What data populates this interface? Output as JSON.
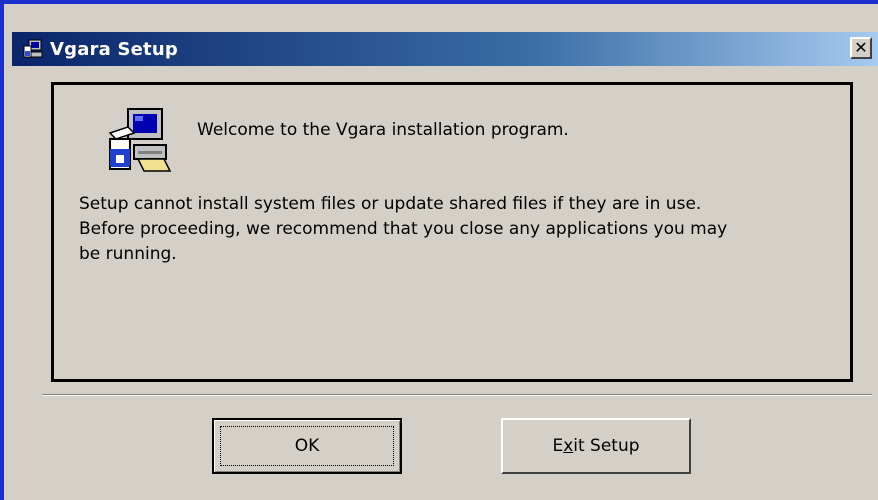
{
  "window": {
    "title": "Vgara Setup",
    "close_label": "✕",
    "icon": "setup-computer-icon"
  },
  "content": {
    "icon": "setup-computer-icon",
    "welcome": "Welcome to the Vgara installation program.",
    "line1": "Setup cannot install system files or update shared files if they are in use.",
    "line2": "Before proceeding, we recommend that you close any applications you may",
    "line3": "be running."
  },
  "buttons": {
    "ok_label": "OK",
    "exit_prefix": "E",
    "exit_accel": "x",
    "exit_suffix": "it Setup"
  },
  "colors": {
    "titlebar_start": "#0a246a",
    "titlebar_end": "#a6caf0",
    "face": "#d4d0c8"
  }
}
